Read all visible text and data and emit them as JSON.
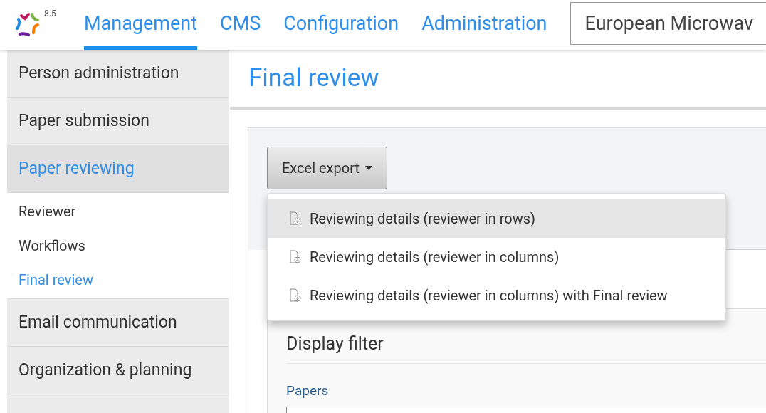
{
  "logo": {
    "version": "8.5"
  },
  "nav_tabs": [
    {
      "label": "Management",
      "selected": true
    },
    {
      "label": "CMS",
      "selected": false
    },
    {
      "label": "Configuration",
      "selected": false
    },
    {
      "label": "Administration",
      "selected": false
    }
  ],
  "conference_select": {
    "value": "European Microwav"
  },
  "sidebar": [
    {
      "label": "Person administration",
      "selected": false
    },
    {
      "label": "Paper submission",
      "selected": false
    },
    {
      "label": "Paper reviewing",
      "selected": true,
      "children": [
        {
          "label": "Reviewer",
          "selected": false
        },
        {
          "label": "Workflows",
          "selected": false
        },
        {
          "label": "Final review",
          "selected": true
        }
      ]
    },
    {
      "label": "Email communication",
      "selected": false
    },
    {
      "label": "Organization & planning",
      "selected": false
    }
  ],
  "page_title": "Final review",
  "export_button": {
    "label": "Excel export"
  },
  "export_menu": [
    {
      "label": "Reviewing details (reviewer in rows)",
      "selected": true
    },
    {
      "label": "Reviewing details (reviewer in columns)",
      "selected": false
    },
    {
      "label": "Reviewing details (reviewer in columns) with Final review",
      "selected": false
    }
  ],
  "filter": {
    "title": "Display filter",
    "field_label": "Papers"
  }
}
